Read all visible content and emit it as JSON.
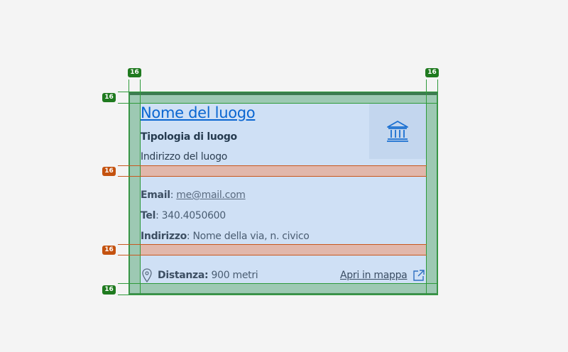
{
  "spacing_badges": {
    "top_left": "16",
    "top_right": "16",
    "left_top": "16",
    "left_mid_1": "16",
    "left_mid_2": "16",
    "left_bottom": "16"
  },
  "place": {
    "title": "Nome del luogo",
    "type": "Tipologia di luogo",
    "address": "Indirizzo del luogo",
    "icon": "museum-icon"
  },
  "contacts": {
    "email_label": "Email",
    "email_value": "me@mail.com",
    "tel_label": "Tel",
    "tel_value": "340.4050600",
    "address_label": "Indirizzo",
    "address_value": "Nome della via, n. civico"
  },
  "footer": {
    "distance_label": "Distanza:",
    "distance_value": "900 metri",
    "map_link": "Apri in mappa"
  },
  "colors": {
    "card_bg": "#cfe0f5",
    "link": "#0a66d1",
    "spacing_green": "#1f7a1f",
    "spacing_orange": "#c4520f"
  }
}
